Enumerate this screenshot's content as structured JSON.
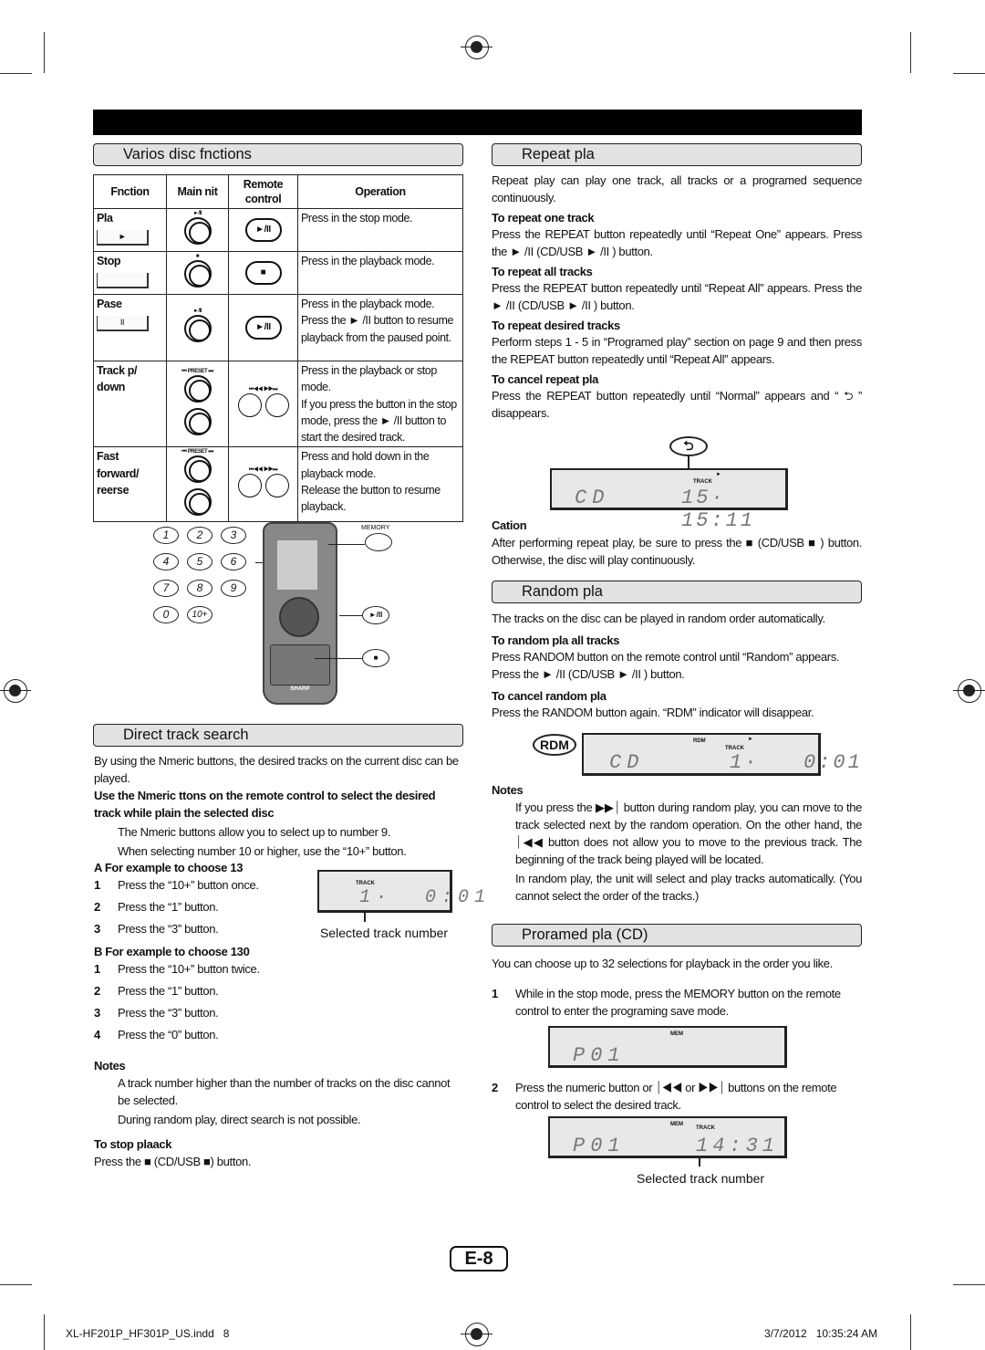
{
  "header_bar": {
    "color": "#000000"
  },
  "left": {
    "functions": {
      "title": "Varios disc fnctions",
      "headers": [
        "Fnction",
        "Main nit",
        "Remote control",
        "Operation"
      ],
      "rows": [
        {
          "function": "Pla",
          "panel_symbol": "►",
          "main_label": "►/II",
          "remote_label": "►/II",
          "operation": "Press in the stop mode."
        },
        {
          "function": "Stop",
          "panel_symbol": "",
          "main_label": "■",
          "remote_label": "■",
          "operation": "Press in the playback mode."
        },
        {
          "function": "Pase",
          "panel_symbol": "II",
          "main_label": "►/II",
          "remote_label": "►/II",
          "operation": "Press in the playback mode. Press the ► /II button to resume playback from the paused point."
        },
        {
          "function": "Track p/ down",
          "main_label": "⏮ PRESET ⏭",
          "remote_label": "⏮◀◀ ▶▶⏭",
          "operation": "Press in the playback or stop mode.",
          "operation2": "If you press the button in the stop mode, press the ► /II button to start the desired track."
        },
        {
          "function": "Fast forward/ reerse",
          "main_label": "⏮ PRESET ⏭",
          "remote_label": "⏮◀◀ ▶▶⏭",
          "operation": "Press and hold down in the playback mode.",
          "operation2": "Release the button to resume playback."
        }
      ]
    },
    "remote": {
      "keys": [
        "1",
        "2",
        "3",
        "4",
        "5",
        "6",
        "7",
        "8",
        "9",
        "0",
        "10+"
      ],
      "memory_label": "MEMORY",
      "play_label": "►/II",
      "stop_label": "■",
      "brand": "SHARP"
    },
    "direct": {
      "title": "Direct track search",
      "intro": "By using the Nmeric buttons, the desired tracks on the current disc can be played.",
      "bold": "Use the Nmeric ttons on the remote control to select the desired track while plain the selected disc",
      "b1": "The Nmeric buttons allow you to select up to number 9.",
      "b2": "When selecting number 10 or higher, use the “10+” button.",
      "a_title": "A For example to choose 13",
      "a_steps": [
        "Press the “10+” button once.",
        "Press the “1” button.",
        "Press the “3” button."
      ],
      "b_title": "B For example to choose 130",
      "b_steps": [
        "Press the “10+” button twice.",
        "Press the “1” button.",
        "Press the “3” button.",
        "Press the “0” button."
      ],
      "lcd": {
        "track": "TRACK",
        "value": "1·  0:01"
      },
      "caption": "Selected track number",
      "notes_title": "Notes",
      "notes": [
        "A track number higher than the number of tracks on the disc cannot be selected.",
        "During random play, direct search is not possible."
      ],
      "stop_title": "To stop plaack",
      "stop_text": "Press the ■ (CD/USB ■) button."
    }
  },
  "right": {
    "repeat": {
      "title": "Repeat pla",
      "intro": "Repeat play can play one track, all tracks or a programed sequence continuously.",
      "items": [
        {
          "h": "To repeat one track",
          "p": "Press the REPEAT button repeatedly until “Repeat One” appears. Press the ► /II (CD/USB ► /II ) button."
        },
        {
          "h": "To repeat all tracks",
          "p": "Press the REPEAT button repeatedly until “Repeat All” appears. Press the ► /II (CD/USB ► /II ) button."
        },
        {
          "h": "To repeat desired tracks",
          "p": "Perform steps 1 - 5 in “Programed play” section on page 9 and then press the REPEAT button repeatedly until “Repeat All” appears."
        },
        {
          "h": "To cancel repeat pla",
          "p": "Press the REPEAT button repeatedly until “Normal” appears and “ ⮌ ” disappears."
        }
      ],
      "lcd": {
        "track": "TRACK",
        "left": "CD",
        "right": "15· 15:11",
        "repeat_icon": "repeat-icon"
      },
      "caution_title": "Cation",
      "caution": "After performing repeat play, be sure to press the ■ (CD/USB ■ ) button. Otherwise, the disc will play continuously."
    },
    "random": {
      "title": "Random pla",
      "intro": "The tracks on the disc can be played in random order automatically.",
      "h1": "To random pla all tracks",
      "p1": "Press RANDOM button on the remote control until “Random” appears. Press the ► /II (CD/USB ► /II ) button.",
      "h2": "To cancel random pla",
      "p2": "Press the RANDOM button again. “RDM” indicator will disappear.",
      "lcd": {
        "badge": "RDM",
        "rdm": "RDM",
        "track": "TRACK",
        "left": "CD",
        "right": "1·   0:01"
      },
      "notes_title": "Notes",
      "notes": [
        "If you press the ▶▶⏐ button during random play, you can move to the track selected next by the random operation. On the other hand, the ⏐◀◀ button does not allow you to move to the previous track. The beginning of the track being played will be located.",
        "In random play, the unit will select and play tracks automatically. (You cannot select the order of the tracks.)"
      ]
    },
    "program": {
      "title": "Proramed pla (CD)",
      "intro": "You can choose up to 32 selections for playback in the order you like.",
      "step1": "While in the stop mode, press the MEMORY button on the remote control to enter the programing save mode.",
      "lcd1": {
        "mem": "MEM",
        "left": "P01"
      },
      "step2": "Press the numeric button or ⏐◀◀ or ▶▶⏐ buttons on the remote control to select the desired track.",
      "lcd2": {
        "mem": "MEM",
        "track": "TRACK",
        "left": "P01",
        "right": "14:31"
      },
      "caption": "Selected track number"
    }
  },
  "page_number": "E-8",
  "footer": {
    "file": "XL-HF201P_HF301P_US.indd   8",
    "date": "3/7/2012   10:35:24 AM"
  }
}
